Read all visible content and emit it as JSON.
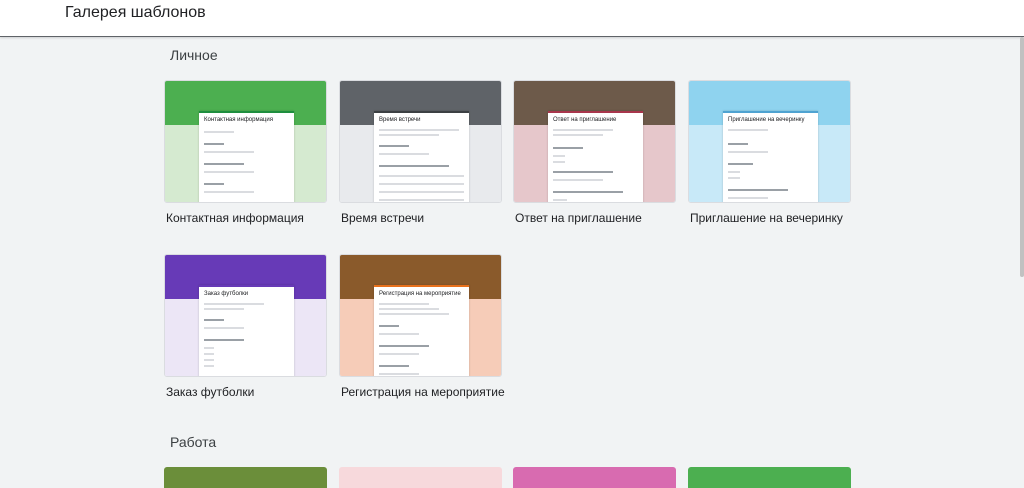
{
  "header": {
    "title": "Галерея шаблонов"
  },
  "sections": [
    {
      "title": "Личное",
      "templates": [
        {
          "label": "Контактная информация",
          "form_title": "Контактная информация",
          "header_color": "#4caf50",
          "bg_color": "#d5ead0",
          "accent": "#1e8e3e"
        },
        {
          "label": "Время встречи",
          "form_title": "Время встречи",
          "header_color": "#5f6368",
          "bg_color": "#e8eaed",
          "accent": "#3c4043"
        },
        {
          "label": "Ответ на приглашение",
          "form_title": "Ответ на приглашение",
          "header_color": "#6d5a4a",
          "bg_color": "#e6c7cb",
          "accent": "#a8364c"
        },
        {
          "label": "Приглашение на вечеринку",
          "form_title": "Приглашение на вечеринку",
          "header_color": "#8fd3ef",
          "bg_color": "#c8e9f8",
          "accent": "#4fa3d1"
        },
        {
          "label": "Заказ футболки",
          "form_title": "Заказ футболки",
          "header_color": "#673ab7",
          "bg_color": "#ece6f6",
          "accent": "#673ab7"
        },
        {
          "label": "Регистрация на мероприятие",
          "form_title": "Регистрация на мероприятие",
          "header_color": "#8a5a2b",
          "bg_color": "#f6ccb8",
          "accent": "#e8711c"
        }
      ]
    },
    {
      "title": "Работа",
      "strips": [
        "#6b8e3a",
        "#f7d9dc",
        "#d86bb0",
        "#4caf50"
      ]
    }
  ]
}
